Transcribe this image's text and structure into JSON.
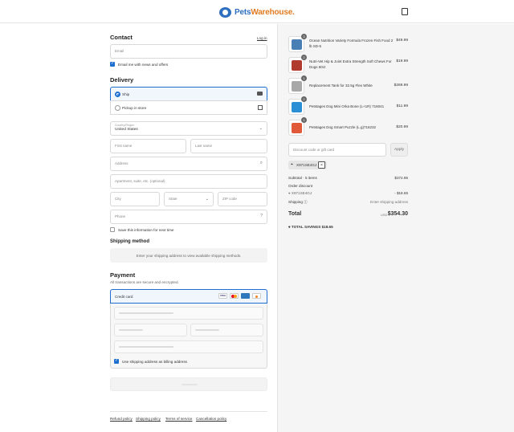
{
  "header": {
    "logo_text_a": "Pets",
    "logo_text_b": "Warehouse."
  },
  "contact": {
    "title": "Contact",
    "login_link": "Log in",
    "email_placeholder": "Email",
    "news_label": "Email me with news and offers"
  },
  "delivery": {
    "title": "Delivery",
    "ship_label": "Ship",
    "pickup_label": "Pickup in store",
    "country_label": "Country/Region",
    "country_value": "United States",
    "first_name": "First name",
    "last_name": "Last name",
    "address": "Address",
    "apartment": "Apartment, suite, etc. (optional)",
    "city": "City",
    "state": "State",
    "zip": "ZIP code",
    "phone": "Phone",
    "save_info": "Save this information for next time"
  },
  "shipping_method": {
    "title": "Shipping method",
    "note": "Enter your shipping address to view available shipping methods."
  },
  "payment": {
    "title": "Payment",
    "subtitle": "All transactions are secure and encrypted.",
    "credit_card": "Credit card",
    "cards": [
      "VISA",
      "MC",
      "AMEX",
      "DISC"
    ],
    "billing_same": "Use shipping address as billing address"
  },
  "footer": {
    "links": [
      "Refund policy",
      "Shipping policy",
      "Terms of service",
      "Cancellation policy"
    ]
  },
  "summary": {
    "products": [
      {
        "qty": "3",
        "name": "Ocean Nutrition Variety Formula Frozen Fish Food 2 lb SD-5",
        "price": "$49.99",
        "color": "#4a7fb5"
      },
      {
        "qty": "2",
        "name": "Nutri-Vet Hip & Joint Extra Strength Soft Chews For Dogs 60ct",
        "price": "$19.99",
        "color": "#b03a2e"
      },
      {
        "qty": "1",
        "name": "Replacement Tank for 32.5g Flex White",
        "price": "$269.99",
        "color": "#a8a8a8"
      },
      {
        "qty": "2",
        "name": "Petstages Dog Mini Orka Bone (L+1R) 716041",
        "price": "$11.99",
        "color": "#2b8fd6"
      },
      {
        "qty": "1",
        "name": "Petstages Dog Smart Puzzle (L.g)716232",
        "price": "$20.99",
        "color": "#e05a3a"
      }
    ],
    "discount_placeholder": "Discount code or gift card",
    "apply_label": "Apply",
    "code_tag": "X971SE4GJ",
    "subtotal_label": "Subtotal · 5 items",
    "subtotal_value": "$372.95",
    "order_discount_label": "Order discount",
    "order_discount_code": "X971SE4GJ",
    "order_discount_value": "- $18.65",
    "shipping_label": "Shipping",
    "shipping_value": "Enter shipping address",
    "total_label": "Total",
    "currency": "USD",
    "total_value": "$354.30",
    "savings_label": "TOTAL SAVINGS",
    "savings_value": "$18.65"
  },
  "colors": {
    "accent": "#1f6fd1",
    "brand": "#2f6fbf",
    "brand_orange": "#e07b22"
  }
}
